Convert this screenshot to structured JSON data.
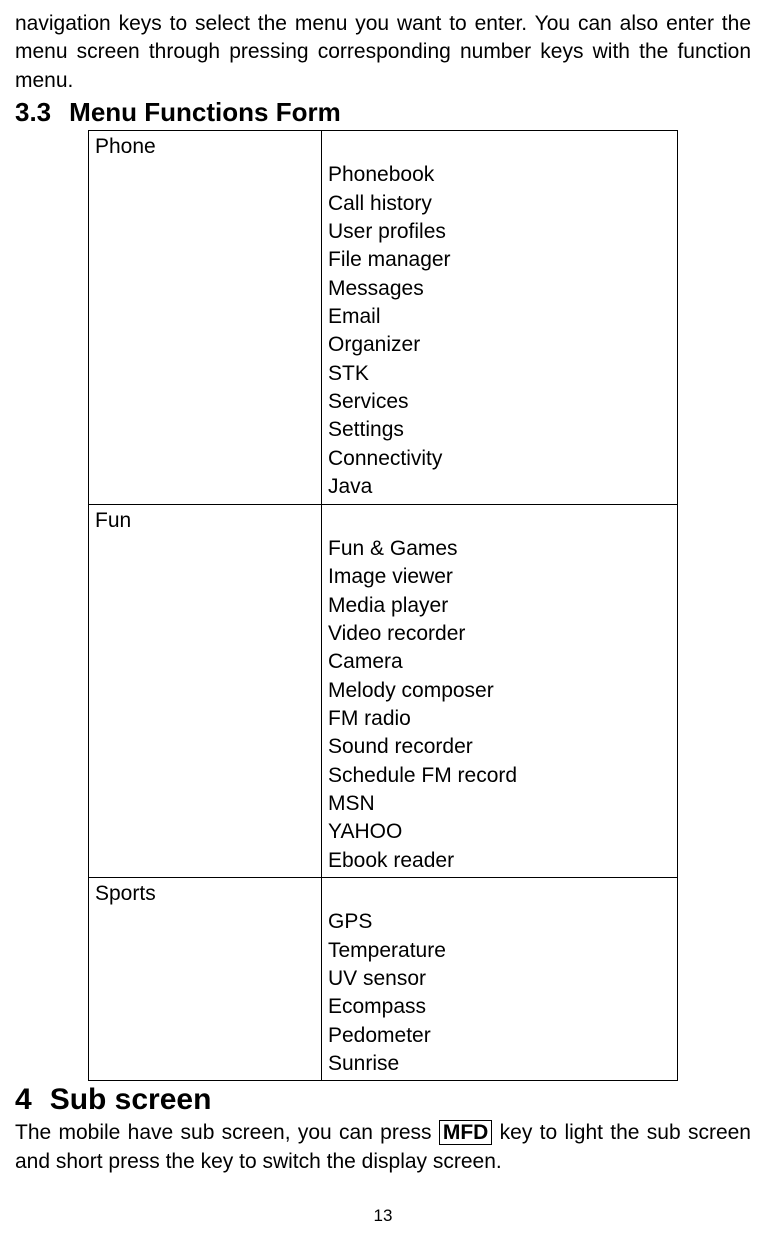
{
  "intro": "navigation keys to select the menu you want to enter. You can also enter the menu screen through pressing corresponding number keys with the function menu.",
  "section": {
    "number": "3.3",
    "title": "Menu Functions Form"
  },
  "table": {
    "rows": [
      {
        "category": "Phone",
        "items": "\nPhonebook\nCall history\nUser profiles\nFile manager\nMessages\nEmail\nOrganizer\nSTK\nServices\nSettings\nConnectivity\nJava"
      },
      {
        "category": "Fun",
        "items": "\nFun & Games\nImage viewer\nMedia player\nVideo recorder\nCamera\nMelody composer\nFM radio\nSound recorder\nSchedule FM record\nMSN\nYAHOO\nEbook reader"
      },
      {
        "category": "Sports",
        "items": "\nGPS\nTemperature\nUV sensor\nEcompass\nPedometer\nSunrise"
      }
    ]
  },
  "chapter": {
    "number": "4",
    "title": "Sub screen"
  },
  "body": {
    "part1": "The mobile have sub screen, you can press ",
    "key": "MFD",
    "part2": " key to light the sub screen and short press the key to switch the display screen."
  },
  "pageNumber": "13"
}
